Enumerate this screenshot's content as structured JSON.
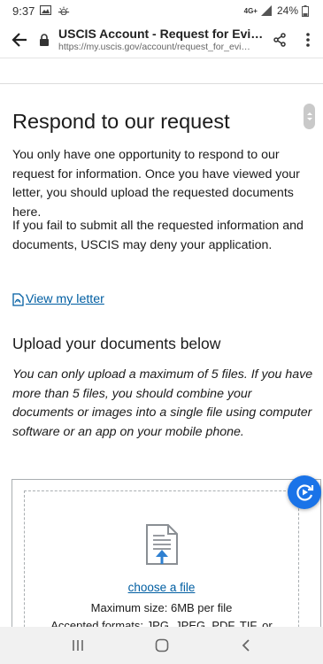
{
  "status_bar": {
    "time": "9:37",
    "network": "4G+",
    "battery": "24%"
  },
  "browser": {
    "page_title": "USCIS Account - Request for Evid…",
    "url": "https://my.uscis.gov/account/request_for_evi…"
  },
  "main": {
    "heading": "Respond to our request",
    "paragraph_1": "You only have one opportunity to respond to our request for information. Once you have viewed your letter, you should upload the requested documents here.",
    "paragraph_2": "If you fail to submit all the requested information and documents, USCIS may deny your application.",
    "view_letter_link": "View my letter",
    "upload_heading": "Upload your documents below",
    "upload_note": "You can only upload a maximum of 5 files. If you have more than 5 files, you should combine your documents or images into a single file using computer software or an app on your mobile phone."
  },
  "upload_box": {
    "choose_file_link": "choose a file",
    "max_size": "Maximum size: 6MB per file",
    "accepted_formats": "Accepted formats: JPG, JPEG, PDF, TIF, or"
  },
  "colors": {
    "link": "#005ea2",
    "fab": "#1a73e8"
  }
}
